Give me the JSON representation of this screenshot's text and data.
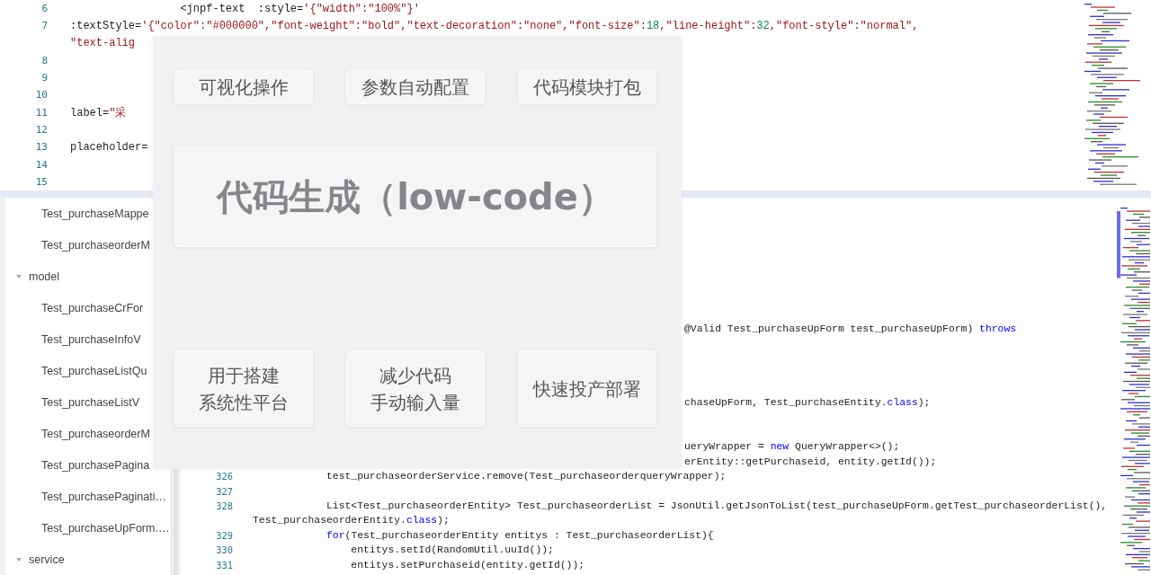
{
  "top_editor": {
    "lines": [
      {
        "kind": "code",
        "number": "6",
        "tokens": [
          {
            "kind": "plain",
            "t": "                 <jnpf-text  :style="
          },
          {
            "kind": "string",
            "t": "'{\"width\":\"100%\"}'"
          }
        ]
      },
      {
        "kind": "code",
        "number": "7",
        "tokens": [
          {
            "kind": "plain",
            "t": ":textStyle="
          },
          {
            "kind": "string",
            "t": "'{\"color\":\"#000000\",\"font-weight\":\"bold\",\"text-decoration\":\"none\",\"font-size\":"
          },
          {
            "kind": "number",
            "t": "18"
          },
          {
            "kind": "string",
            "t": ",\"line-height\":"
          },
          {
            "kind": "number",
            "t": "32"
          },
          {
            "kind": "string",
            "t": ",\"font-style\":\"normal\","
          }
        ],
        "wrap": [
          {
            "kind": "string",
            "t": "\"text-alig"
          }
        ]
      },
      {
        "kind": "code",
        "number": "8"
      },
      {
        "kind": "code",
        "number": "9"
      },
      {
        "kind": "code",
        "number": "10"
      },
      {
        "kind": "code",
        "number": "11",
        "tokens": [
          {
            "kind": "plain",
            "t": "label="
          },
          {
            "kind": "string",
            "t": "\"采"
          }
        ]
      },
      {
        "kind": "code",
        "number": "12"
      },
      {
        "kind": "code",
        "number": "13",
        "tokens": [
          {
            "kind": "plain",
            "t": "placeholder="
          }
        ]
      },
      {
        "kind": "code",
        "number": "14"
      },
      {
        "kind": "code",
        "number": "15"
      }
    ]
  },
  "file_tree": [
    {
      "label": "Test_purchaseMappe",
      "kind": "file"
    },
    {
      "label": "Test_purchaseorderM",
      "kind": "file"
    },
    {
      "label": "model",
      "kind": "folder",
      "expanded": true,
      "children": [
        {
          "label": "Test_purchaseCrFor",
          "kind": "file"
        },
        {
          "label": "Test_purchaseInfoV",
          "kind": "file"
        },
        {
          "label": "Test_purchaseListQu",
          "kind": "file"
        },
        {
          "label": "Test_purchaseListV",
          "kind": "file"
        },
        {
          "label": "Test_purchaseorderM",
          "kind": "file"
        },
        {
          "label": "Test_purchasePagina",
          "kind": "file"
        },
        {
          "label": "Test_purchasePaginati…",
          "kind": "file"
        },
        {
          "label": "Test_purchaseUpForm.…",
          "kind": "file"
        }
      ]
    },
    {
      "label": "service",
      "kind": "folder",
      "expanded": true
    }
  ],
  "bottom_editor": {
    "lines": [
      {
        "kind": "hidden"
      },
      {
        "kind": "hidden"
      },
      {
        "kind": "hidden"
      },
      {
        "kind": "hidden"
      },
      {
        "kind": "hidden"
      },
      {
        "kind": "hidden"
      },
      {
        "kind": "hidden"
      },
      {
        "kind": "hidden"
      },
      {
        "kind": "tail",
        "tokens": [
          {
            "kind": "plain",
            "t": "@Valid Test_purchaseUpForm test_purchaseUpForm) "
          },
          {
            "kind": "keyword",
            "t": "throws"
          }
        ]
      },
      {
        "kind": "hidden"
      },
      {
        "kind": "hidden"
      },
      {
        "kind": "hidden"
      },
      {
        "kind": "hidden"
      },
      {
        "kind": "tail",
        "tokens": [
          {
            "kind": "plain",
            "t": "chaseUpForm, Test_purchaseEntity."
          },
          {
            "kind": "keyword",
            "t": "class"
          },
          {
            "kind": "plain",
            "t": ");"
          }
        ]
      },
      {
        "kind": "hidden"
      },
      {
        "kind": "hidden"
      },
      {
        "kind": "tail",
        "tokens": [
          {
            "kind": "plain",
            "t": "ueryWrapper = "
          },
          {
            "kind": "keyword",
            "t": "new"
          },
          {
            "kind": "plain",
            "t": " QueryWrapper<>();"
          }
        ]
      },
      {
        "kind": "tail",
        "tokens": [
          {
            "kind": "plain",
            "t": "erEntity::getPurchaseid, entity.getId());"
          }
        ]
      },
      {
        "kind": "code",
        "number": "326",
        "tokens": [
          {
            "kind": "plain",
            "t": "            test_purchaseorderService.remove(Test_purchaseorderqueryWrapper);"
          }
        ]
      },
      {
        "kind": "code",
        "number": "327"
      },
      {
        "kind": "code",
        "number": "328",
        "tokens": [
          {
            "kind": "plain",
            "t": "            List<Test_purchaseorderEntity> Test_purchaseorderList = JsonUtil.getJsonToList(test_purchaseUpForm.getTest_purchaseorderList(),"
          }
        ],
        "wrap": [
          {
            "kind": "plain",
            "t": "Test_purchaseorderEntity."
          },
          {
            "kind": "keyword",
            "t": "class"
          },
          {
            "kind": "plain",
            "t": ");"
          }
        ]
      },
      {
        "kind": "code",
        "number": "329",
        "tokens": [
          {
            "kind": "keyword",
            "t": "            for"
          },
          {
            "kind": "plain",
            "t": "(Test_purchaseorderEntity entitys : Test_purchaseorderList){"
          }
        ]
      },
      {
        "kind": "code",
        "number": "330",
        "tokens": [
          {
            "kind": "plain",
            "t": "                entitys.setId(RandomUtil.uuId());"
          }
        ]
      },
      {
        "kind": "code",
        "number": "331",
        "tokens": [
          {
            "kind": "plain",
            "t": "                entitys.setPurchaseid(entity.getId());"
          }
        ]
      }
    ]
  },
  "overlay": {
    "features_top": [
      "可视化操作",
      "参数自动配置",
      "代码模块打包"
    ],
    "headline": "代码生成（low-code）",
    "features_bottom": [
      {
        "lines": [
          "用于搭建",
          "系统性平台"
        ]
      },
      {
        "lines": [
          "减少代码",
          "手动输入量"
        ]
      },
      {
        "lines": [
          "快速投产部署"
        ]
      }
    ]
  }
}
